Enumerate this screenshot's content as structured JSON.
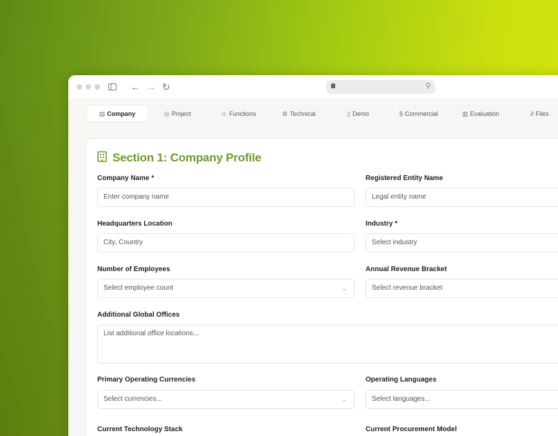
{
  "tabs": [
    {
      "label": "Company",
      "icon": "building-icon",
      "active": true
    },
    {
      "label": "Project",
      "icon": "target-icon"
    },
    {
      "label": "Functions",
      "icon": "users-icon"
    },
    {
      "label": "Technical",
      "icon": "gear-icon"
    },
    {
      "label": "Demo",
      "icon": "document-icon"
    },
    {
      "label": "Commercial",
      "icon": "dollar-icon"
    },
    {
      "label": "Evaluation",
      "icon": "bar-chart-icon"
    },
    {
      "label": "Files",
      "icon": "paperclip-icon"
    }
  ],
  "section": {
    "title": "Section 1: Company Profile",
    "icon": "building-icon"
  },
  "fields": {
    "company_name": {
      "label": "Company Name *",
      "placeholder": "Enter company name"
    },
    "entity_name": {
      "label": "Registered Entity Name",
      "placeholder": "Legal entity name"
    },
    "hq_location": {
      "label": "Headquarters Location",
      "placeholder": "City, Country"
    },
    "industry": {
      "label": "Industry *",
      "placeholder": "Select industry"
    },
    "employees": {
      "label": "Number of Employees",
      "placeholder": "Select employee count"
    },
    "revenue": {
      "label": "Annual Revenue Bracket",
      "placeholder": "Select revenue bracket"
    },
    "offices": {
      "label": "Additional Global Offices",
      "placeholder": "List additional office locations..."
    },
    "currencies": {
      "label": "Primary Operating Currencies",
      "placeholder": "Select currencies..."
    },
    "languages": {
      "label": "Operating Languages",
      "placeholder": "Select languages..."
    },
    "tech_stack": {
      "label": "Current Technology Stack"
    },
    "procurement": {
      "label": "Current Procurement Model"
    }
  },
  "colors": {
    "accent": "#6e9a2e",
    "background_from": "#5f8a14",
    "background_to": "#d4e60e"
  }
}
